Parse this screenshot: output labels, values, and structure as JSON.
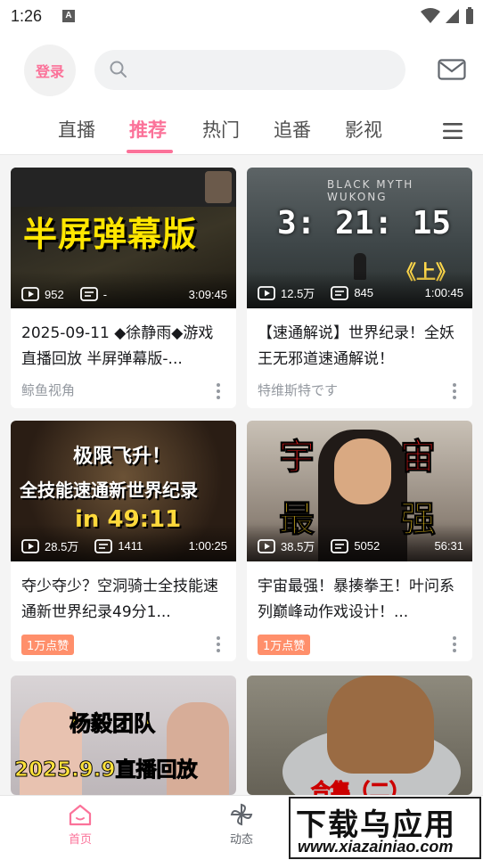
{
  "status_bar": {
    "time": "1:26",
    "notification_letter": "A"
  },
  "header": {
    "login_label": "登录",
    "search_placeholder": "",
    "icons": [
      "search-icon",
      "mail-icon"
    ]
  },
  "tabs": [
    {
      "label": "直播",
      "active": false
    },
    {
      "label": "推荐",
      "active": true
    },
    {
      "label": "热门",
      "active": false
    },
    {
      "label": "追番",
      "active": false
    },
    {
      "label": "影视",
      "active": false
    }
  ],
  "colors": {
    "accent": "#fb7299",
    "badge": "#ff8f6b",
    "muted": "#9499a0"
  },
  "cards": [
    {
      "thumb_text": "半屏弹幕版",
      "views": "952",
      "danmaku": "-",
      "duration": "3:09:45",
      "title": "2025-09-11 ◆徐静雨◆游戏直播回放 半屏弹幕版-...",
      "author": "鲸鱼视角",
      "badge": ""
    },
    {
      "thumb_text": "3: 21: 15",
      "thumb_sub": "《上》",
      "thumb_brand": "BLACK MYTH WUKONG",
      "views": "12.5万",
      "danmaku": "845",
      "duration": "1:00:45",
      "title": "【速通解说】世界纪录！全妖王无邪道速通解说！",
      "author": "特维斯特です",
      "badge": ""
    },
    {
      "thumb_lines": [
        "极限飞升！",
        "全技能速通新世界纪录",
        "in 49:11"
      ],
      "views": "28.5万",
      "danmaku": "1411",
      "duration": "1:00:25",
      "title": "夺少夺少？空洞骑士全技能速通新世界纪录49分1...",
      "author": "",
      "badge": "1万点赞"
    },
    {
      "thumb_lines": [
        "宇",
        "宙",
        "最",
        "强"
      ],
      "views": "38.5万",
      "danmaku": "5052",
      "duration": "56:31",
      "title": "宇宙最强！暴揍拳王！叶问系列巅峰动作戏设计！...",
      "author": "",
      "badge": "1万点赞"
    },
    {
      "thumb_lines": [
        "杨毅团队",
        "2025.9.9直播回放"
      ],
      "title": "",
      "author": "",
      "badge": ""
    },
    {
      "thumb_lines": [
        "合集（二）"
      ],
      "title": "",
      "author": "",
      "badge": ""
    }
  ],
  "bottom_nav": [
    {
      "label": "首页",
      "icon": "home-icon",
      "active": true
    },
    {
      "label": "动态",
      "icon": "pinwheel-icon",
      "active": false
    }
  ],
  "watermark": {
    "text": "下载乌应用",
    "url": "www.xiazainiao.com"
  }
}
